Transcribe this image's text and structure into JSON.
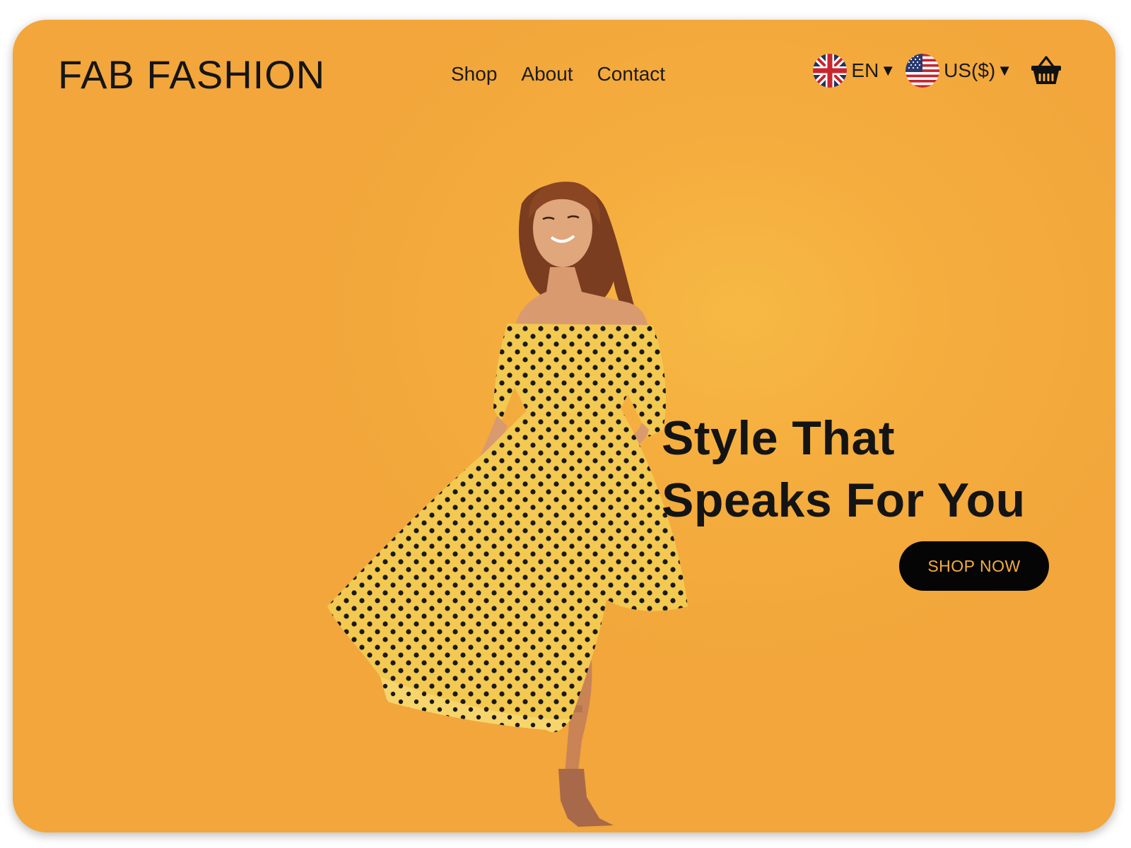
{
  "brand": {
    "name": "FAB FASHION"
  },
  "nav": {
    "items": [
      {
        "label": "Shop"
      },
      {
        "label": "About"
      },
      {
        "label": "Contact"
      }
    ]
  },
  "language_selector": {
    "value": "EN",
    "icon": "uk-flag-icon"
  },
  "currency_selector": {
    "value": "US($)",
    "icon": "us-flag-icon"
  },
  "cart": {
    "icon": "shopping-basket-icon"
  },
  "hero": {
    "headline_line1": "Style That",
    "headline_line2": "Speaks For You",
    "cta_label": "SHOP NOW",
    "image": "woman-in-polka-dot-dress"
  },
  "colors": {
    "background": "#f5ad3e",
    "text": "#151515",
    "cta_background": "#050505",
    "cta_text": "#f5ad3e",
    "dress": "#f3c951",
    "dots": "#1a1a1a"
  }
}
